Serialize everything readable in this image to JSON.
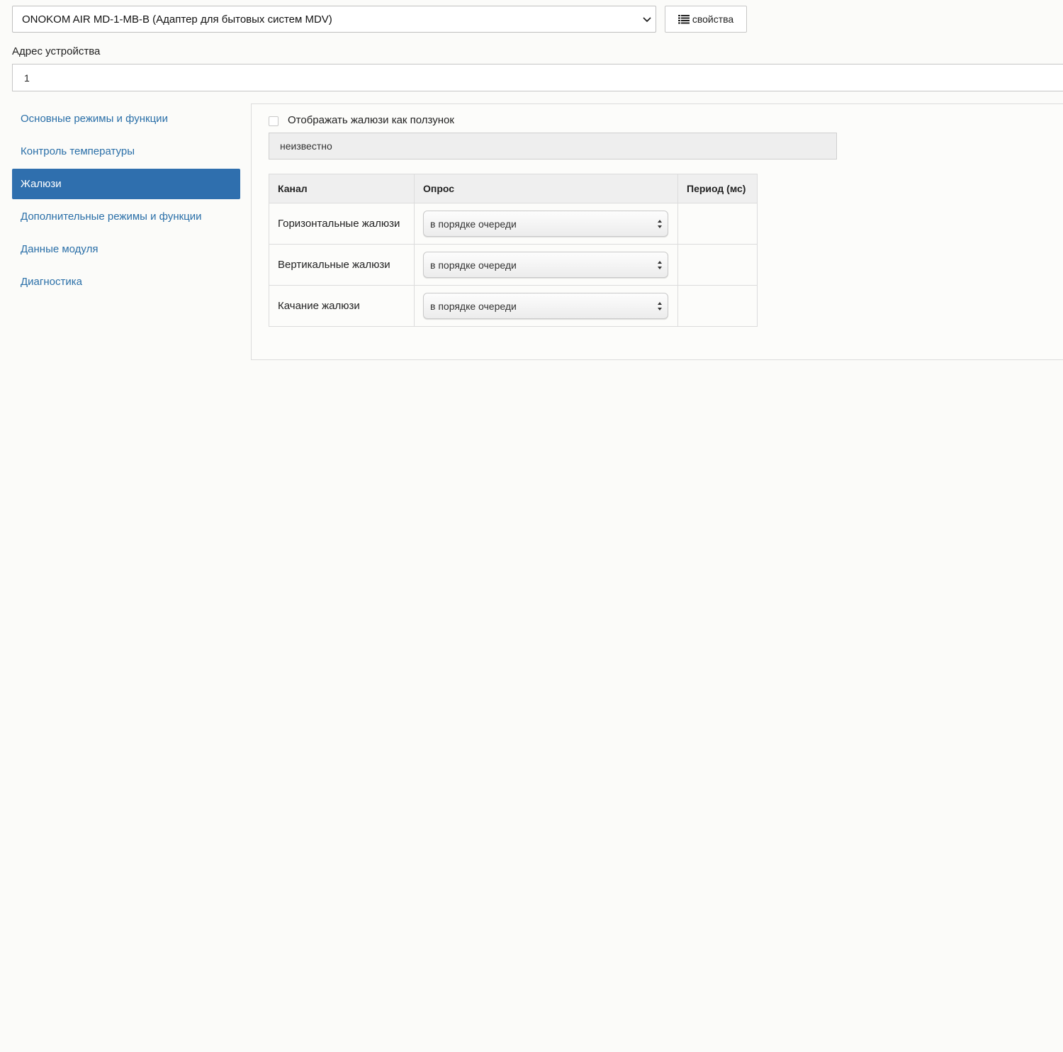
{
  "device": {
    "selected": "ONOKOM AIR MD-1-MB-B (Адаптер для бытовых систем MDV)",
    "properties_label": "свойства"
  },
  "address": {
    "label": "Адрес устройства",
    "value": "1"
  },
  "sidebar": {
    "items": [
      {
        "label": "Основные режимы и функции",
        "active": false
      },
      {
        "label": "Контроль температуры",
        "active": false
      },
      {
        "label": "Жалюзи",
        "active": true
      },
      {
        "label": "Дополнительные режимы и функции",
        "active": false
      },
      {
        "label": "Данные модуля",
        "active": false
      },
      {
        "label": "Диагностика",
        "active": false
      }
    ]
  },
  "panel": {
    "checkbox_label": "Отображать жалюзи как ползунок",
    "checkbox_checked": false,
    "status_value": "неизвестно",
    "table": {
      "headers": [
        "Канал",
        "Опрос",
        "Период (мс)"
      ],
      "rows": [
        {
          "channel": "Горизонтальные жалюзи",
          "poll": "в порядке очереди",
          "period": ""
        },
        {
          "channel": "Вертикальные жалюзи",
          "poll": "в порядке очереди",
          "period": ""
        },
        {
          "channel": "Качание жалюзи",
          "poll": "в порядке очереди",
          "period": ""
        }
      ]
    }
  },
  "colors": {
    "accent": "#2f6fae",
    "link": "#2a6fa8",
    "background": "#fbfbf9"
  }
}
